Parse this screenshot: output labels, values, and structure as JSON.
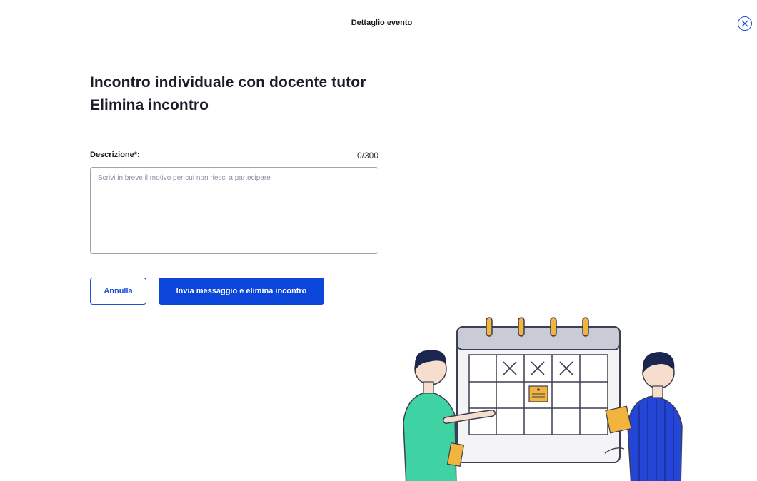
{
  "header": {
    "title": "Dettaglio evento",
    "close_icon": "close-circle-icon"
  },
  "main": {
    "title_line1": "Incontro individuale con docente tutor",
    "title_line2": "Elimina incontro"
  },
  "form": {
    "description_label": "Descrizione*:",
    "char_counter": "0/300",
    "description_value": "",
    "description_placeholder": "Scrivi in breve il motivo per cui non riesci a partecipare"
  },
  "actions": {
    "cancel_label": "Annulla",
    "submit_label": "Invia messaggio e elimina incontro"
  },
  "illustration": {
    "name": "calendar-people-illustration"
  },
  "colors": {
    "accent": "#0b45d9",
    "text": "#1c1c28",
    "border": "#9aa2ad"
  }
}
